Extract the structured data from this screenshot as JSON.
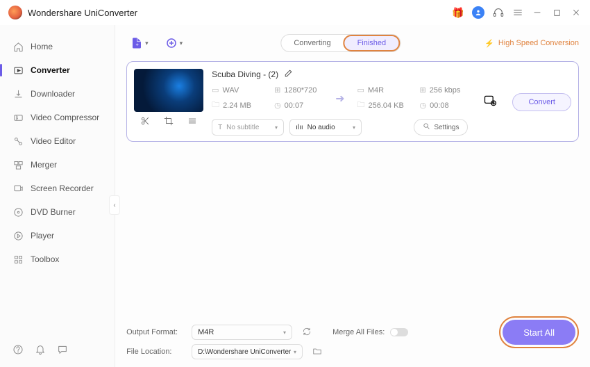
{
  "app": {
    "title": "Wondershare UniConverter"
  },
  "titlebar_icons": {
    "gift": "🎁"
  },
  "sidebar": {
    "items": [
      {
        "label": "Home"
      },
      {
        "label": "Converter"
      },
      {
        "label": "Downloader"
      },
      {
        "label": "Video Compressor"
      },
      {
        "label": "Video Editor"
      },
      {
        "label": "Merger"
      },
      {
        "label": "Screen Recorder"
      },
      {
        "label": "DVD Burner"
      },
      {
        "label": "Player"
      },
      {
        "label": "Toolbox"
      }
    ]
  },
  "tabs": {
    "converting": "Converting",
    "finished": "Finished"
  },
  "speed_link": "High Speed Conversion",
  "file": {
    "title": "Scuba Diving - (2)",
    "src": {
      "format": "WAV",
      "resolution": "1280*720",
      "size": "2.24 MB",
      "duration": "00:07"
    },
    "dst": {
      "format": "M4R",
      "bitrate": "256 kbps",
      "size": "256.04 KB",
      "duration": "00:08"
    },
    "subtitle": "No subtitle",
    "audio": "No audio",
    "settings": "Settings",
    "convert": "Convert"
  },
  "footer": {
    "output_format_label": "Output Format:",
    "output_format": "M4R",
    "merge_label": "Merge All Files:",
    "file_location_label": "File Location:",
    "file_location": "D:\\Wondershare UniConverter",
    "start_all": "Start All"
  }
}
